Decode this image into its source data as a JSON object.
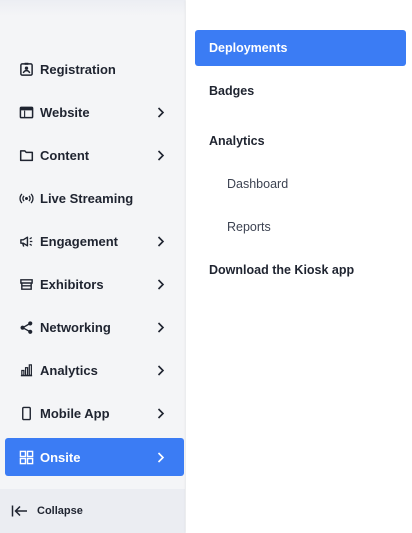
{
  "sidebar": {
    "items": [
      {
        "label": "Registration",
        "icon": "id-badge-icon",
        "has_submenu": false
      },
      {
        "label": "Website",
        "icon": "browser-window-icon",
        "has_submenu": true
      },
      {
        "label": "Content",
        "icon": "folder-icon",
        "has_submenu": true
      },
      {
        "label": "Live Streaming",
        "icon": "broadcast-icon",
        "has_submenu": false
      },
      {
        "label": "Engagement",
        "icon": "megaphone-icon",
        "has_submenu": true
      },
      {
        "label": "Exhibitors",
        "icon": "booth-icon",
        "has_submenu": true
      },
      {
        "label": "Networking",
        "icon": "share-nodes-icon",
        "has_submenu": true
      },
      {
        "label": "Analytics",
        "icon": "bar-chart-icon",
        "has_submenu": true
      },
      {
        "label": "Mobile App",
        "icon": "mobile-phone-icon",
        "has_submenu": true
      },
      {
        "label": "Onsite",
        "icon": "grid-icon",
        "has_submenu": true,
        "active": true
      }
    ],
    "collapse_label": "Collapse"
  },
  "flyout": {
    "items": [
      {
        "label": "Deployments",
        "selected": true
      },
      {
        "label": "Badges"
      },
      {
        "label": "Analytics"
      },
      {
        "label": "Dashboard",
        "sub": true
      },
      {
        "label": "Reports",
        "sub": true
      },
      {
        "label": "Download the Kiosk app"
      }
    ]
  },
  "colors": {
    "accent": "#3b7cf4",
    "sidebar_bg": "#f4f5f7",
    "flyout_bg": "#ffffff",
    "text": "#1f2430"
  }
}
